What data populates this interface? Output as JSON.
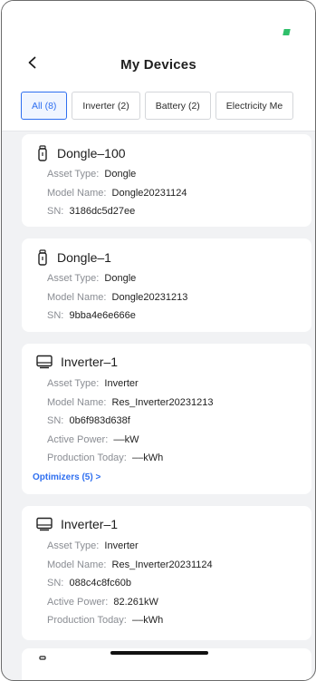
{
  "header": {
    "title": "My Devices"
  },
  "tabs": [
    {
      "label": "All (8)",
      "active": true
    },
    {
      "label": "Inverter (2)",
      "active": false
    },
    {
      "label": "Battery (2)",
      "active": false
    },
    {
      "label": "Electricity Me",
      "active": false
    }
  ],
  "labels": {
    "asset_type": "Asset Type:",
    "model_name": "Model Name:",
    "sn": "SN:",
    "active_power": "Active Power:",
    "production_today": "Production Today:"
  },
  "devices": [
    {
      "name": "Dongle–100",
      "icon": "dongle-icon",
      "asset_type": "Dongle",
      "model_name": "Dongle20231124",
      "sn": "3186dc5d27ee"
    },
    {
      "name": "Dongle–1",
      "icon": "dongle-icon",
      "asset_type": "Dongle",
      "model_name": "Dongle20231213",
      "sn": "9bba4e6e666e"
    },
    {
      "name": "Inverter–1",
      "icon": "inverter-icon",
      "asset_type": "Inverter",
      "model_name": "Res_Inverter20231213",
      "sn": "0b6f983d638f",
      "active_power": "––kW",
      "production_today": "––kWh",
      "optimizers_link": "Optimizers (5) >"
    },
    {
      "name": "Inverter–1",
      "icon": "inverter-icon",
      "asset_type": "Inverter",
      "model_name": "Res_Inverter20231124",
      "sn": "088c4c8fc60b",
      "active_power": "82.261kW",
      "production_today": "––kWh"
    }
  ],
  "colors": {
    "accent": "#2f6ff0",
    "battery": "#2fbf6a",
    "background": "#f1f2f4"
  }
}
